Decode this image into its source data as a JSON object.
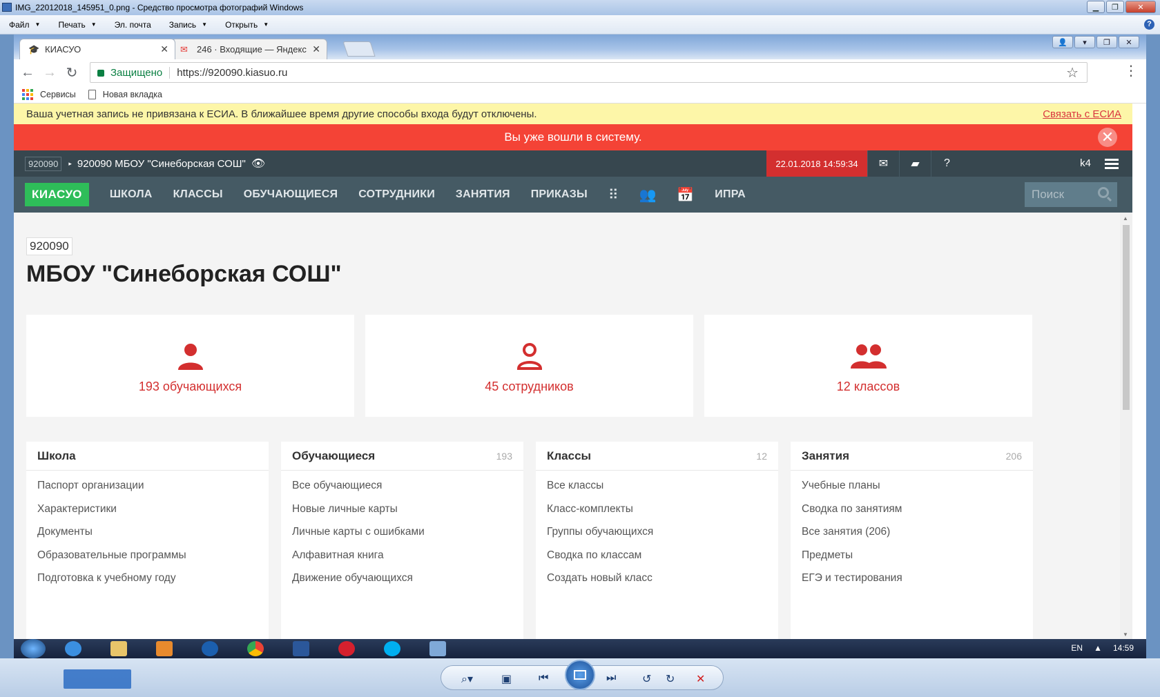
{
  "viewer": {
    "title": "IMG_22012018_145951_0.png - Средство просмотра фотографий Windows",
    "menu": [
      {
        "label": "Файл",
        "arrow": true
      },
      {
        "label": "Печать",
        "arrow": true
      },
      {
        "label": "Эл. почта",
        "arrow": false
      },
      {
        "label": "Запись",
        "arrow": true
      },
      {
        "label": "Открыть",
        "arrow": true
      }
    ]
  },
  "browser": {
    "tabs": [
      {
        "label": "КИАСУО",
        "icon": "graduation-cap-icon"
      },
      {
        "label": "246 · Входящие — Яндекс",
        "icon": "mail-icon"
      }
    ],
    "secure_label": "Защищено",
    "url": "https://920090.kiasuo.ru",
    "bookmarks": [
      "Сервисы",
      "Новая вкладка"
    ]
  },
  "page": {
    "esia_notice": "Ваша учетная запись не привязана к ЕСИА. В ближайшее время другие способы входа будут отключены.",
    "esia_link": "Связать с ЕСИА",
    "alert": "Вы уже вошли в систему.",
    "topbar": {
      "code": "920090",
      "org": "920090 МБОУ \"Синеборская СОШ\"",
      "datetime": "22.01.2018 14:59:34",
      "user": "k4"
    },
    "nav": {
      "brand": "КИАСУО",
      "items": [
        "ШКОЛА",
        "КЛАССЫ",
        "ОБУЧАЮЩИЕСЯ",
        "СОТРУДНИКИ",
        "ЗАНЯТИЯ",
        "ПРИКАЗЫ"
      ],
      "extra": "ИПРА",
      "search_placeholder": "Поиск"
    },
    "org_code": "920090",
    "org_title": "МБОУ \"Синеборская СОШ\"",
    "stats": [
      {
        "label": "193 обучающихся",
        "icon": "person-icon"
      },
      {
        "label": "45 сотрудников",
        "icon": "person-outline-icon"
      },
      {
        "label": "12 классов",
        "icon": "group-icon"
      }
    ],
    "cards": [
      {
        "title": "Школа",
        "count": "",
        "items": [
          "Паспорт организации",
          "Характеристики",
          "Документы",
          "Образовательные программы",
          "Подготовка к учебному году"
        ]
      },
      {
        "title": "Обучающиеся",
        "count": "193",
        "items": [
          "Все обучающиеся",
          "Новые личные карты",
          "Личные карты с ошибками",
          "Алфавитная книга",
          "Движение обучающихся"
        ]
      },
      {
        "title": "Классы",
        "count": "12",
        "items": [
          "Все классы",
          "Класс-комплекты",
          "Группы обучающихся",
          "Сводка по классам",
          "Создать новый класс"
        ]
      },
      {
        "title": "Занятия",
        "count": "206",
        "items": [
          "Учебные планы",
          "Сводка по занятиям",
          "Все занятия (206)",
          "Предметы",
          "ЕГЭ и тестирования"
        ]
      }
    ]
  },
  "taskbar": {
    "lang": "EN",
    "time": "14:59"
  },
  "colors": {
    "brand_green": "#2ebd59",
    "alert_red": "#f44336",
    "nav_bg": "#455a64",
    "topbar_bg": "#37474f",
    "accent_red": "#d32f2f"
  }
}
